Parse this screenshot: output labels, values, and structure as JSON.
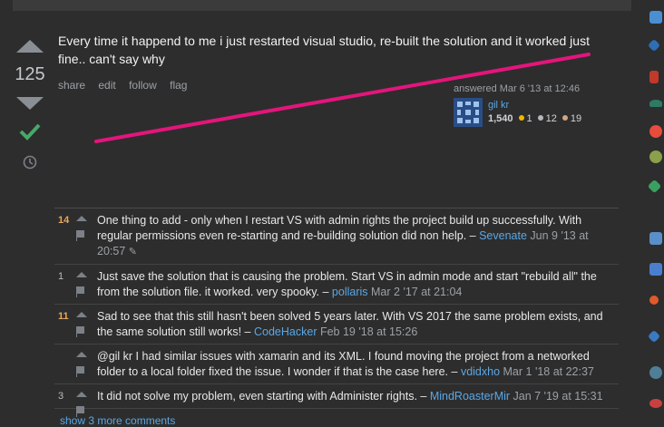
{
  "answer": {
    "score": "125",
    "text": "Every time it happend to me i just restarted visual studio, re-built the solution and it worked just fine.. can't say why",
    "menu": [
      "share",
      "edit",
      "follow",
      "flag"
    ],
    "answered": "answered Mar 6 '13 at 12:46",
    "user": {
      "name": "gil kr",
      "reputation": "1,540",
      "gold": "1",
      "silver": "12",
      "bronze": "19"
    }
  },
  "comments": [
    {
      "score": "14",
      "highlight": true,
      "text": "One thing to add - only when I restart VS with admin rights the project build up successfully. With regular permissions even re-starting and re-building solution did non help. –",
      "user": "Sevenate",
      "date": "Jun 9 '13 at 20:57",
      "edit_icon": "pencil-icon"
    },
    {
      "score": "1",
      "highlight": false,
      "text": "Just save the solution that is causing the problem. Start VS in admin mode and start \"rebuild all\" the from the solution file. it worked. very spooky. –",
      "user": "pollaris",
      "date": "Mar 2 '17 at 21:04"
    },
    {
      "score": "11",
      "highlight": true,
      "text": "Sad to see that this still hasn't been solved 5 years later. With VS 2017 the same problem exists, and the same solution still works! –",
      "user": "CodeHacker",
      "date": "Feb 19 '18 at 15:26"
    },
    {
      "score": "",
      "highlight": false,
      "text": "@gil kr I had similar issues with xamarin and its XML. I found moving the project from a networked folder to a local folder fixed the issue. I wonder if that is the case here. –",
      "user": "vdidxho",
      "date": "Mar 1 '18 at 22:37"
    },
    {
      "score": "3",
      "highlight": false,
      "text": "It did not solve my problem, even starting with Administer rights. –",
      "user": "MindRoasterMir",
      "date": "Jan 7 '19 at 15:31"
    }
  ],
  "show_more": "show 3 more comments",
  "colors": {
    "annotation_line": "#e3157b",
    "accepted": "#48a868",
    "link": "#5aa7e6",
    "highlight_score": "#e8a85a"
  }
}
